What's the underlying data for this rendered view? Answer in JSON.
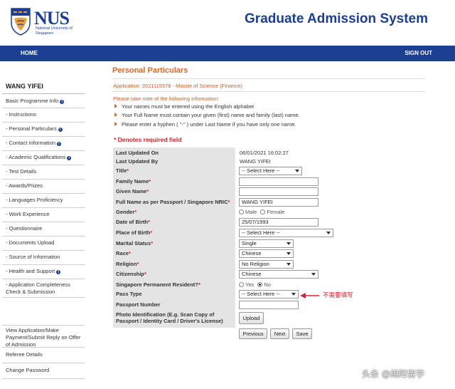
{
  "header": {
    "logo_text": "NUS",
    "logo_subtitle": "National University of Singapore",
    "app_title": "Graduate Admission System"
  },
  "nav": {
    "home": "HOME",
    "signout": "SIGN OUT"
  },
  "sidebar": {
    "user": "WANG YIFEI",
    "items": [
      {
        "label": "Basic Programme Info",
        "info": true
      },
      {
        "label": "- Instructions",
        "info": false
      },
      {
        "label": "- Personal Particulars",
        "info": true
      },
      {
        "label": "- Contact Information",
        "info": true
      },
      {
        "label": "- Academic Qualifications",
        "info": true
      },
      {
        "label": "- Test Details",
        "info": false
      },
      {
        "label": "- Awards/Prizes",
        "info": false
      },
      {
        "label": "- Languages Proficiency",
        "info": false
      },
      {
        "label": "- Work Experience",
        "info": false
      },
      {
        "label": "- Questionnaire",
        "info": false
      },
      {
        "label": "- Documents Upload",
        "info": false
      },
      {
        "label": "- Source of Information",
        "info": false
      },
      {
        "label": "- Health and Support",
        "info": true
      },
      {
        "label": "- Application Completeness Check & Submission",
        "info": false
      },
      {
        "label": "View Application/Make Payment/Submit Reply on Offer of Admission",
        "info": false
      },
      {
        "label": "Referee Details",
        "info": false
      },
      {
        "label": "Change Password",
        "info": false
      }
    ]
  },
  "main": {
    "title": "Personal Particulars",
    "application": "Application: 2021115578 - Master of Science (Finance)",
    "note_heading": "Please take note of the following information:",
    "notes": [
      "Your names must be entered using the English alphabet",
      "Your Full Name must contain your given (first) name and family (last) name.",
      "Please enter a hyphen ( \"-\" ) under Last Name if you have only one name."
    ],
    "required_note": "* Denotes required field"
  },
  "form": {
    "last_updated_on": {
      "label": "Last Updated On",
      "value": "06/01/2021 16:02:27"
    },
    "last_updated_by": {
      "label": "Last Updated By",
      "value": "WANG YIFEI"
    },
    "title": {
      "label": "Title",
      "value": "-- Select Here --"
    },
    "family_name": {
      "label": "Family Name",
      "value": ""
    },
    "given_name": {
      "label": "Given Name",
      "value": ""
    },
    "full_name": {
      "label": "Full Name as per Passport / Singapore NRIC",
      "value": "WANG YIFEI"
    },
    "gender": {
      "label": "Gender",
      "option_male": "Male",
      "option_female": "Female"
    },
    "dob": {
      "label": "Date of Birth",
      "value": "25/07/1993"
    },
    "place_of_birth": {
      "label": "Place of Birth",
      "value": "-- Select Here --"
    },
    "marital_status": {
      "label": "Marital Status",
      "value": "Single"
    },
    "race": {
      "label": "Race",
      "value": "Chinese"
    },
    "religion": {
      "label": "Religion",
      "value": "No Religion"
    },
    "citizenship": {
      "label": "Citizenship",
      "value": "Chinese"
    },
    "spr": {
      "label": "Singapore Permanent Resident?",
      "option_yes": "Yes",
      "option_no": "No"
    },
    "pass_type": {
      "label": "Pass Type",
      "value": "-- Select Here --"
    },
    "passport_number": {
      "label": "Passport Number",
      "value": ""
    },
    "photo_id": {
      "label": "Photo Identification (E.g. Scan Copy of Passport / Identity Card / Driver's License)"
    },
    "upload_label": "Upload",
    "required_star": "*"
  },
  "buttons": {
    "previous": "Previous",
    "next": "Next",
    "save": "Save"
  },
  "annotation": {
    "text": "不需要填写"
  },
  "watermark": "头条 @绵阳留学",
  "colors": {
    "brand_blue": "#1c3f94",
    "accent_orange": "#d4692a",
    "required_red": "#d8232a"
  }
}
